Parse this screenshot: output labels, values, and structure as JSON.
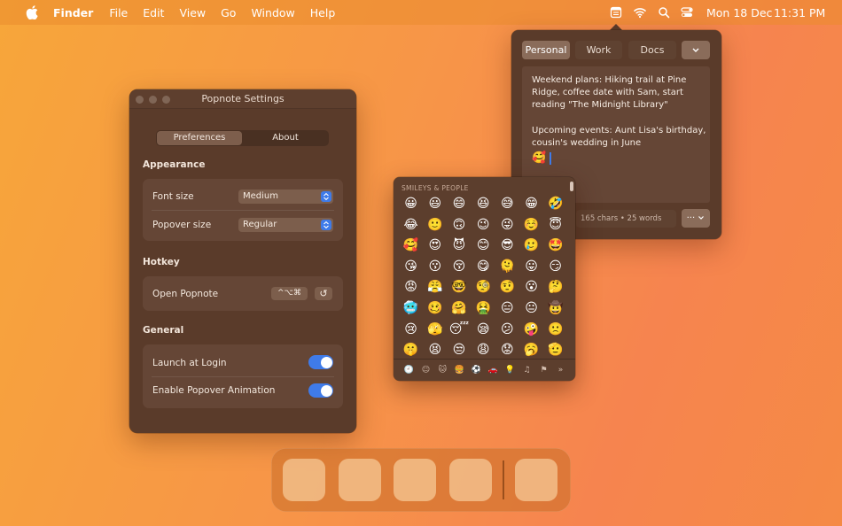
{
  "menubar": {
    "app_name": "Finder",
    "menus": [
      "File",
      "Edit",
      "View",
      "Go",
      "Window",
      "Help"
    ],
    "date": "Mon 18 Dec",
    "time": "11:31 PM",
    "status_icons": [
      "popnote-icon",
      "wifi-icon",
      "search-icon",
      "control-center-icon"
    ]
  },
  "settings": {
    "title": "Popnote Settings",
    "tabs": [
      "Preferences",
      "About"
    ],
    "active_tab": "Preferences",
    "appearance": {
      "heading": "Appearance",
      "font_size_label": "Font size",
      "font_size_value": "Medium",
      "popover_size_label": "Popover size",
      "popover_size_value": "Regular"
    },
    "hotkey": {
      "heading": "Hotkey",
      "open_label": "Open Popnote",
      "keys": "^⌥⌘",
      "reset_glyph": "↺"
    },
    "general": {
      "heading": "General",
      "launch_label": "Launch at Login",
      "launch_on": true,
      "animation_label": "Enable Popover Animation",
      "animation_on": true
    }
  },
  "popover": {
    "tabs": [
      "Personal",
      "Work",
      "Docs"
    ],
    "active_tab": "Personal",
    "note_paragraphs": [
      "Weekend plans: Hiking trail at Pine Ridge, coffee date with Sam, start reading \"The Midnight Library\"",
      "Upcoming events: Aunt Lisa's birthday, cousin's wedding in June"
    ],
    "note_emoji": "🥰",
    "stats": "165 chars • 25 words",
    "actions_glyph": "···"
  },
  "emoji_picker": {
    "category_title": "SMILEYS & PEOPLE",
    "emojis": [
      "😀",
      "😃",
      "😄",
      "😆",
      "😅",
      "😁",
      "🤣",
      "😂",
      "🙂",
      "🙃",
      "😉",
      "😜",
      "☺️",
      "😇",
      "🥰",
      "😍",
      "😈",
      "😊",
      "😎",
      "🥲",
      "🤩",
      "😘",
      "😗",
      "😚",
      "😋",
      "🫠",
      "😛",
      "😏",
      "😡",
      "😤",
      "🤓",
      "🧐",
      "🤨",
      "😮",
      "🤔",
      "🥶",
      "🥴",
      "🤗",
      "🤮",
      "😑",
      "😐",
      "🤠",
      "😢",
      "🫣",
      "😴",
      "😪",
      "😕",
      "🤪",
      "🙁",
      "🤫",
      "😫",
      "😒",
      "😩",
      "😟",
      "🥱",
      "🫡"
    ],
    "category_icons": [
      "🕘",
      "☺",
      "🐱",
      "🍔",
      "⚽",
      "🚗",
      "💡",
      "♫",
      "⚑",
      "»"
    ]
  },
  "colors": {
    "accent": "#3f7be9",
    "window_bg": "#5a3b2a",
    "desktop_from": "#f7a63a",
    "desktop_to": "#f58a45"
  }
}
